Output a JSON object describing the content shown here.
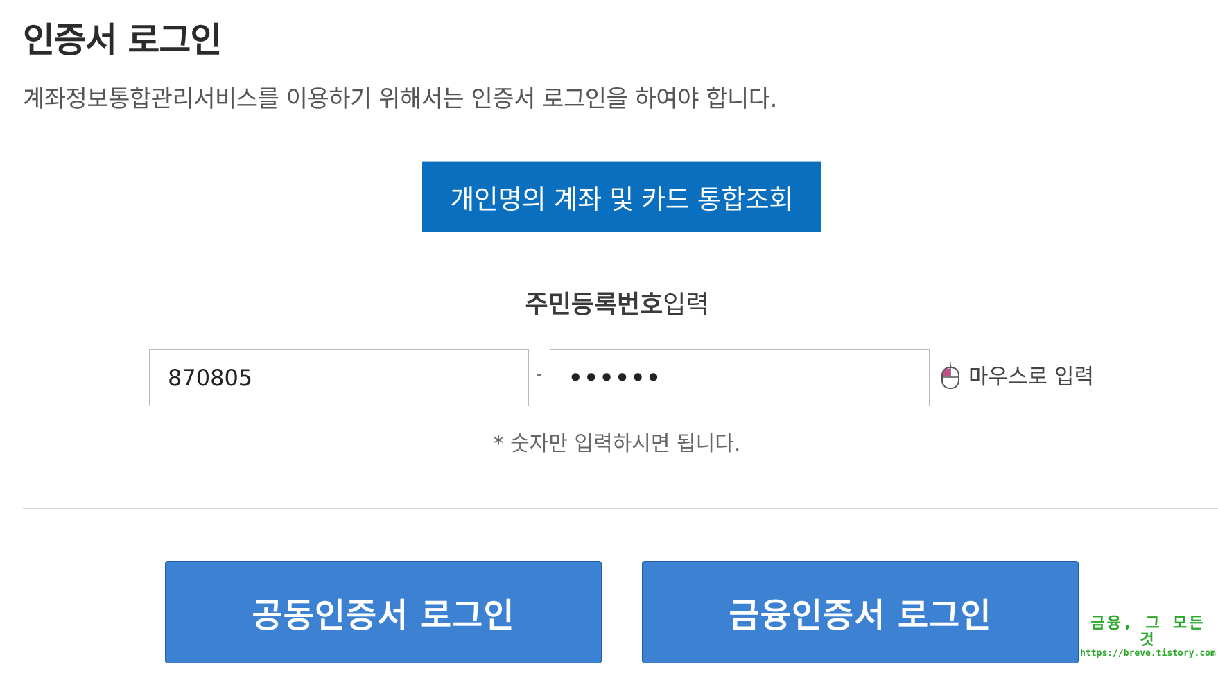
{
  "page": {
    "title": "인증서 로그인",
    "description": "계좌정보통합관리서비스를 이용하기 위해서는 인증서 로그인을 하여야 합니다."
  },
  "inquiry_button": {
    "label": "개인명의 계좌 및 카드 통합조회"
  },
  "ssn": {
    "heading_bold": "주민등록번호",
    "heading_regular": "입력",
    "front_value": "870805",
    "back_value": "••••••",
    "separator": "-",
    "mouse_input_label": "마우스로 입력",
    "mouse_icon": "mouse-icon",
    "hint": "* 숫자만 입력하시면 됩니다."
  },
  "login_buttons": {
    "public_cert": "공동인증서 로그인",
    "finance_cert": "금융인증서 로그인"
  },
  "watermark": {
    "title": "금융, 그 모든 것",
    "url": "https://breve.tistory.com"
  },
  "colors": {
    "inquiry_button": "#0a6fbf",
    "login_button": "#3d82d2",
    "watermark": "#2aa82a"
  }
}
